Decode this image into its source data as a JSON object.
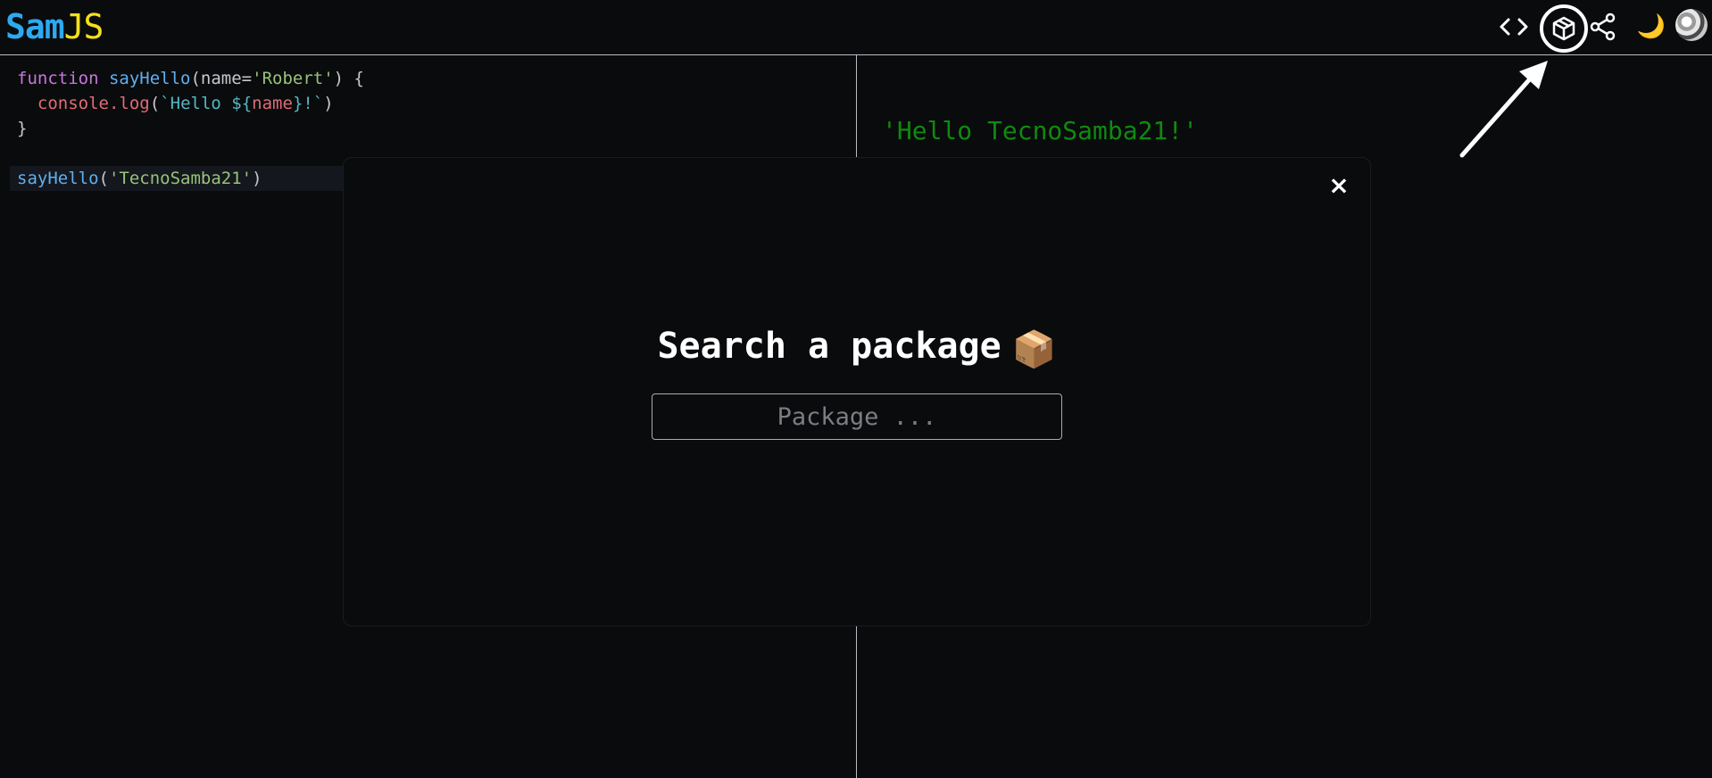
{
  "header": {
    "logo": {
      "part1": "Sam",
      "part2": "JS"
    },
    "buttons": [
      {
        "name": "code",
        "icon": "code-brackets-icon"
      },
      {
        "name": "packages",
        "icon": "package-box-icon"
      },
      {
        "name": "share",
        "icon": "share-icon"
      },
      {
        "name": "theme",
        "icon": "crescent-moon-icon",
        "glyph": "🌙"
      },
      {
        "name": "profile",
        "icon": "avatar-icon"
      }
    ]
  },
  "editor": {
    "lines": [
      {
        "kw": "function",
        "fn": "sayHello",
        "p1": "(name=",
        "str": "'Robert'",
        "p2": ") {"
      },
      {
        "indent": "  ",
        "obj": "console",
        "dot": ".",
        "fn": "log",
        "p1": "(",
        "tpl1": "`Hello ",
        "tpl2": "${",
        "var": "name",
        "tpl3": "}!`",
        "p2": ")"
      },
      {
        "text": "}"
      },
      {
        "fn": "sayHello",
        "p1": "(",
        "str": "'TecnoSamba21'",
        "p2": ")"
      }
    ]
  },
  "output": {
    "text": "'Hello TecnoSamba21!'"
  },
  "modal": {
    "close": "×",
    "title": "Search a package",
    "title_emoji": "📦",
    "input": {
      "placeholder": "Package ...",
      "value": ""
    }
  },
  "colors": {
    "background": "#0a0b0d",
    "logo_sam": "#2ca9f0",
    "logo_js": "#f4e01c",
    "output_green": "#0f8a0f",
    "keyword": "#c678dd",
    "function": "#61afef",
    "string": "#98c379"
  }
}
